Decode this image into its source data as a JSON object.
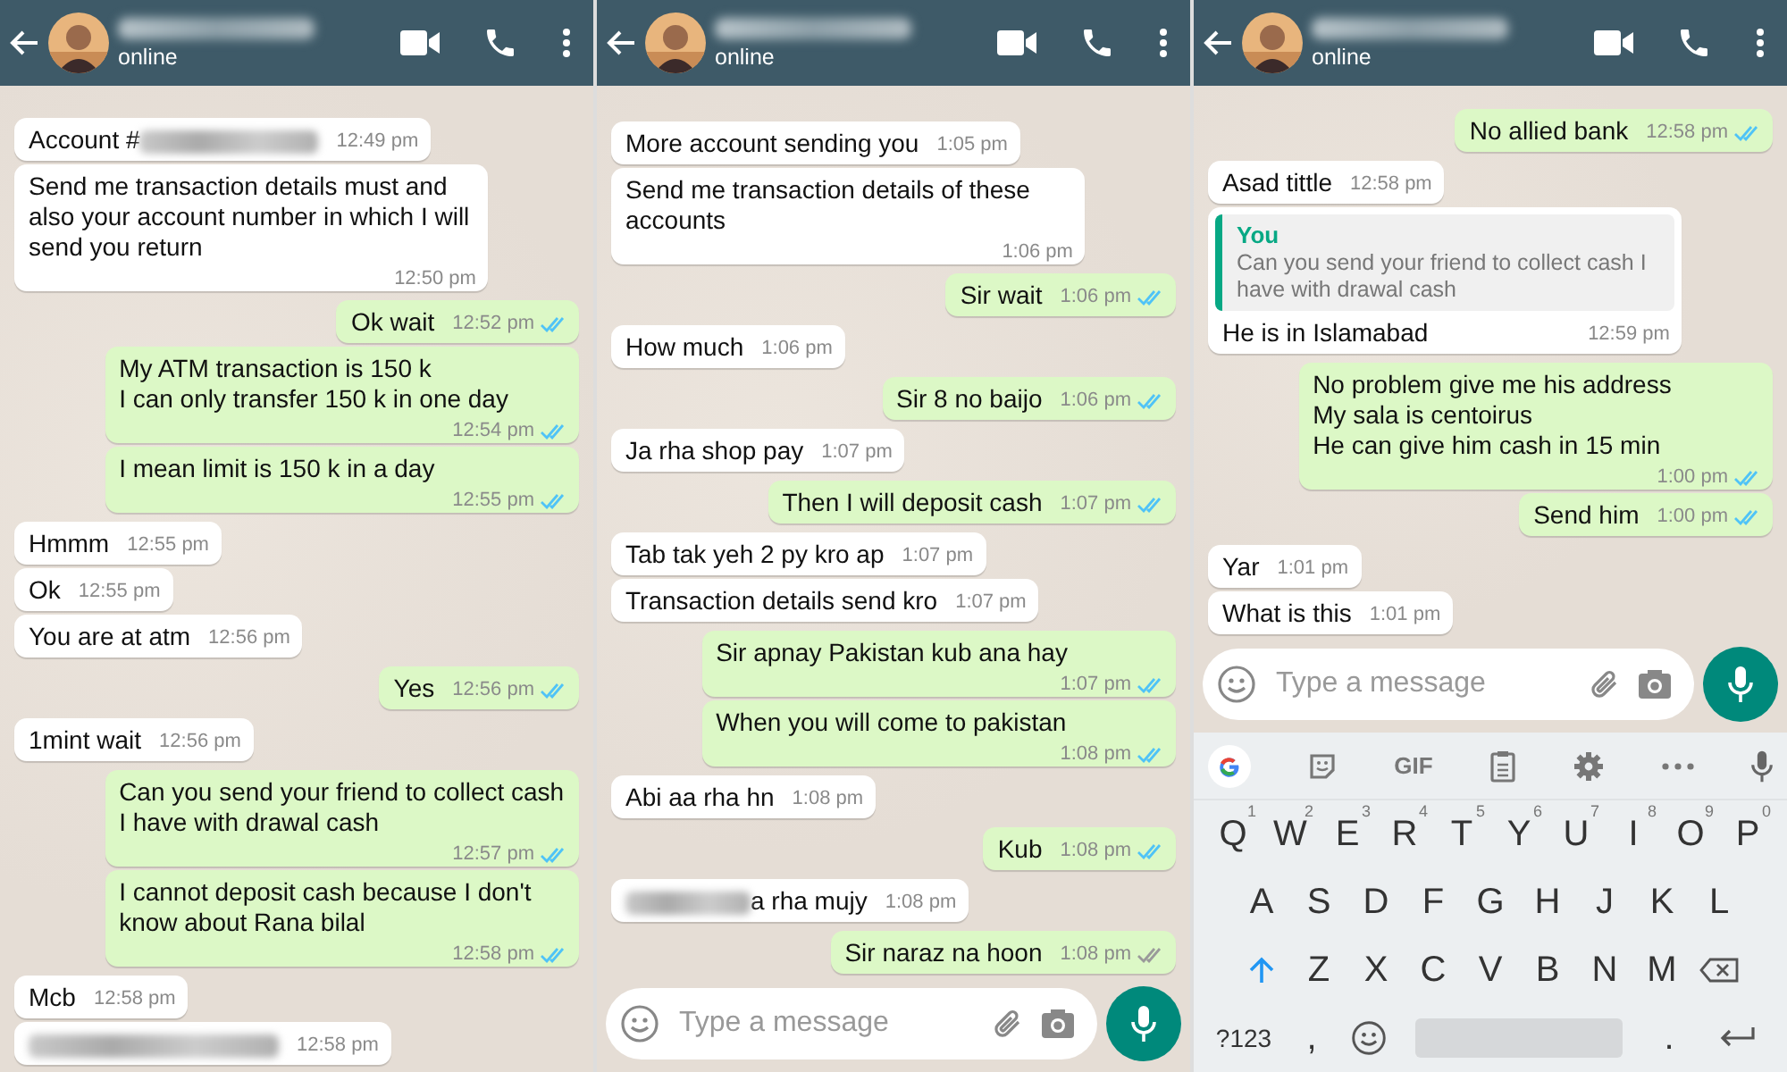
{
  "panels": [
    {
      "header": {
        "status": "online"
      },
      "messages": [
        {
          "outgoing": false,
          "parts": [
            {
              "kind": "text",
              "text": "Account #"
            },
            {
              "kind": "redacted"
            }
          ],
          "time": "12:49 pm"
        },
        {
          "outgoing": false,
          "parts": [
            {
              "kind": "text",
              "text": "Send me transaction details must and also your account number in which I will send you return"
            }
          ],
          "time": "12:50 pm"
        },
        {
          "outgoing": true,
          "parts": [
            {
              "kind": "text",
              "text": "Ok wait"
            }
          ],
          "time": "12:52 pm",
          "read": true
        },
        {
          "outgoing": true,
          "parts": [
            {
              "kind": "text",
              "text": "My ATM transaction is 150 k\nI can only transfer 150 k in one day"
            }
          ],
          "time": "12:54 pm",
          "read": true
        },
        {
          "outgoing": true,
          "parts": [
            {
              "kind": "text",
              "text": "I mean limit is 150 k in a day"
            }
          ],
          "time": "12:55 pm",
          "read": true
        },
        {
          "outgoing": false,
          "parts": [
            {
              "kind": "text",
              "text": "Hmmm"
            }
          ],
          "time": "12:55 pm"
        },
        {
          "outgoing": false,
          "parts": [
            {
              "kind": "text",
              "text": "Ok"
            }
          ],
          "time": "12:55 pm"
        },
        {
          "outgoing": false,
          "parts": [
            {
              "kind": "text",
              "text": "You are at atm"
            }
          ],
          "time": "12:56 pm"
        },
        {
          "outgoing": true,
          "parts": [
            {
              "kind": "text",
              "text": "Yes"
            }
          ],
          "time": "12:56 pm",
          "read": true
        },
        {
          "outgoing": false,
          "parts": [
            {
              "kind": "text",
              "text": "1mint wait"
            }
          ],
          "time": "12:56 pm"
        },
        {
          "outgoing": true,
          "parts": [
            {
              "kind": "text",
              "text": "Can you send your friend to collect cash\nI have with drawal cash"
            }
          ],
          "time": "12:57 pm",
          "read": true
        },
        {
          "outgoing": true,
          "parts": [
            {
              "kind": "text",
              "text": "I cannot deposit cash because I don't know about Rana bilal"
            }
          ],
          "time": "12:58 pm",
          "read": true
        },
        {
          "outgoing": false,
          "parts": [
            {
              "kind": "text",
              "text": "Mcb"
            }
          ],
          "time": "12:58 pm"
        },
        {
          "outgoing": false,
          "parts": [
            {
              "kind": "redacted"
            }
          ],
          "time": "12:58 pm"
        }
      ]
    },
    {
      "header": {
        "status": "online"
      },
      "messages": [
        {
          "outgoing": false,
          "parts": [
            {
              "kind": "text",
              "text": "More account sending you"
            }
          ],
          "time": "1:05 pm"
        },
        {
          "outgoing": false,
          "parts": [
            {
              "kind": "text",
              "text": "Send me transaction details of these accounts"
            }
          ],
          "time": "1:06 pm"
        },
        {
          "outgoing": true,
          "parts": [
            {
              "kind": "text",
              "text": "Sir wait"
            }
          ],
          "time": "1:06 pm",
          "read": true
        },
        {
          "outgoing": false,
          "parts": [
            {
              "kind": "text",
              "text": "How much"
            }
          ],
          "time": "1:06 pm"
        },
        {
          "outgoing": true,
          "parts": [
            {
              "kind": "text",
              "text": "Sir 8 no baijo"
            }
          ],
          "time": "1:06 pm",
          "read": true
        },
        {
          "outgoing": false,
          "parts": [
            {
              "kind": "text",
              "text": "Ja rha shop pay"
            }
          ],
          "time": "1:07 pm"
        },
        {
          "outgoing": true,
          "parts": [
            {
              "kind": "text",
              "text": "Then I will deposit cash"
            }
          ],
          "time": "1:07 pm",
          "read": true
        },
        {
          "outgoing": false,
          "parts": [
            {
              "kind": "text",
              "text": "Tab tak yeh 2 py kro ap"
            }
          ],
          "time": "1:07 pm"
        },
        {
          "outgoing": false,
          "parts": [
            {
              "kind": "text",
              "text": "Transaction details send kro"
            }
          ],
          "time": "1:07 pm"
        },
        {
          "outgoing": true,
          "parts": [
            {
              "kind": "text",
              "text": "Sir apnay Pakistan kub ana hay"
            }
          ],
          "time": "1:07 pm",
          "read": true
        },
        {
          "outgoing": true,
          "parts": [
            {
              "kind": "text",
              "text": "When you will come to pakistan"
            }
          ],
          "time": "1:08 pm",
          "read": true
        },
        {
          "outgoing": false,
          "parts": [
            {
              "kind": "text",
              "text": "Abi aa rha hn"
            }
          ],
          "time": "1:08 pm"
        },
        {
          "outgoing": true,
          "parts": [
            {
              "kind": "text",
              "text": "Kub"
            }
          ],
          "time": "1:08 pm",
          "read": true
        },
        {
          "outgoing": false,
          "parts": [
            {
              "kind": "redacted"
            },
            {
              "kind": "text",
              "text": "a rha mujy"
            }
          ],
          "time": "1:08 pm"
        },
        {
          "outgoing": true,
          "parts": [
            {
              "kind": "text",
              "text": "Sir naraz na hoon"
            }
          ],
          "time": "1:08 pm",
          "read": false
        }
      ],
      "composer": {
        "placeholder": "Type a message"
      }
    },
    {
      "header": {
        "status": "online"
      },
      "messages": [
        {
          "outgoing": true,
          "parts": [
            {
              "kind": "text",
              "text": "No allied bank"
            }
          ],
          "time": "12:58 pm",
          "read": true
        },
        {
          "outgoing": false,
          "parts": [
            {
              "kind": "text",
              "text": "Asad tittle"
            }
          ],
          "time": "12:58 pm"
        },
        {
          "outgoing": false,
          "quote": {
            "author": "You",
            "text": "Can you send your friend to collect cash I have with drawal cash"
          },
          "parts": [
            {
              "kind": "text",
              "text": "He is in Islamabad"
            }
          ],
          "time": "12:59 pm"
        },
        {
          "outgoing": true,
          "parts": [
            {
              "kind": "text",
              "text": "No problem give me his address\nMy sala is centoirus\nHe can give him cash in 15 min"
            }
          ],
          "time": "1:00 pm",
          "read": true
        },
        {
          "outgoing": true,
          "parts": [
            {
              "kind": "text",
              "text": "Send him"
            }
          ],
          "time": "1:00 pm",
          "read": true
        },
        {
          "outgoing": false,
          "parts": [
            {
              "kind": "text",
              "text": "Yar"
            }
          ],
          "time": "1:01 pm"
        },
        {
          "outgoing": false,
          "parts": [
            {
              "kind": "text",
              "text": "What is this"
            }
          ],
          "time": "1:01 pm"
        }
      ],
      "composer": {
        "placeholder": "Type a message"
      },
      "keyboard": {
        "tools": [
          {
            "kind": "google"
          },
          {
            "kind": "sticker"
          },
          {
            "kind": "text",
            "label": "GIF"
          },
          {
            "kind": "clipboard"
          },
          {
            "kind": "settings"
          },
          {
            "kind": "more"
          },
          {
            "kind": "mic"
          }
        ],
        "rows": [
          {
            "keys": [
              {
                "kind": "char",
                "label": "Q",
                "hint": "1"
              },
              {
                "kind": "char",
                "label": "W",
                "hint": "2"
              },
              {
                "kind": "char",
                "label": "E",
                "hint": "3"
              },
              {
                "kind": "char",
                "label": "R",
                "hint": "4"
              },
              {
                "kind": "char",
                "label": "T",
                "hint": "5"
              },
              {
                "kind": "char",
                "label": "Y",
                "hint": "6"
              },
              {
                "kind": "char",
                "label": "U",
                "hint": "7"
              },
              {
                "kind": "char",
                "label": "I",
                "hint": "8"
              },
              {
                "kind": "char",
                "label": "O",
                "hint": "9"
              },
              {
                "kind": "char",
                "label": "P",
                "hint": "0"
              }
            ]
          },
          {
            "keys": [
              {
                "kind": "char",
                "label": "A"
              },
              {
                "kind": "char",
                "label": "S"
              },
              {
                "kind": "char",
                "label": "D"
              },
              {
                "kind": "char",
                "label": "F"
              },
              {
                "kind": "char",
                "label": "G"
              },
              {
                "kind": "char",
                "label": "H"
              },
              {
                "kind": "char",
                "label": "J"
              },
              {
                "kind": "char",
                "label": "K"
              },
              {
                "kind": "char",
                "label": "L"
              }
            ]
          },
          {
            "keys": [
              {
                "kind": "shift"
              },
              {
                "kind": "char",
                "label": "Z"
              },
              {
                "kind": "char",
                "label": "X"
              },
              {
                "kind": "char",
                "label": "C"
              },
              {
                "kind": "char",
                "label": "V"
              },
              {
                "kind": "char",
                "label": "B"
              },
              {
                "kind": "char",
                "label": "N"
              },
              {
                "kind": "char",
                "label": "M"
              },
              {
                "kind": "backspace"
              }
            ]
          },
          {
            "keys": [
              {
                "kind": "char",
                "label": "?123"
              },
              {
                "kind": "char",
                "label": ","
              },
              {
                "kind": "emoji"
              },
              {
                "kind": "space"
              },
              {
                "kind": "char",
                "label": "."
              },
              {
                "kind": "enter"
              }
            ]
          }
        ]
      }
    }
  ]
}
